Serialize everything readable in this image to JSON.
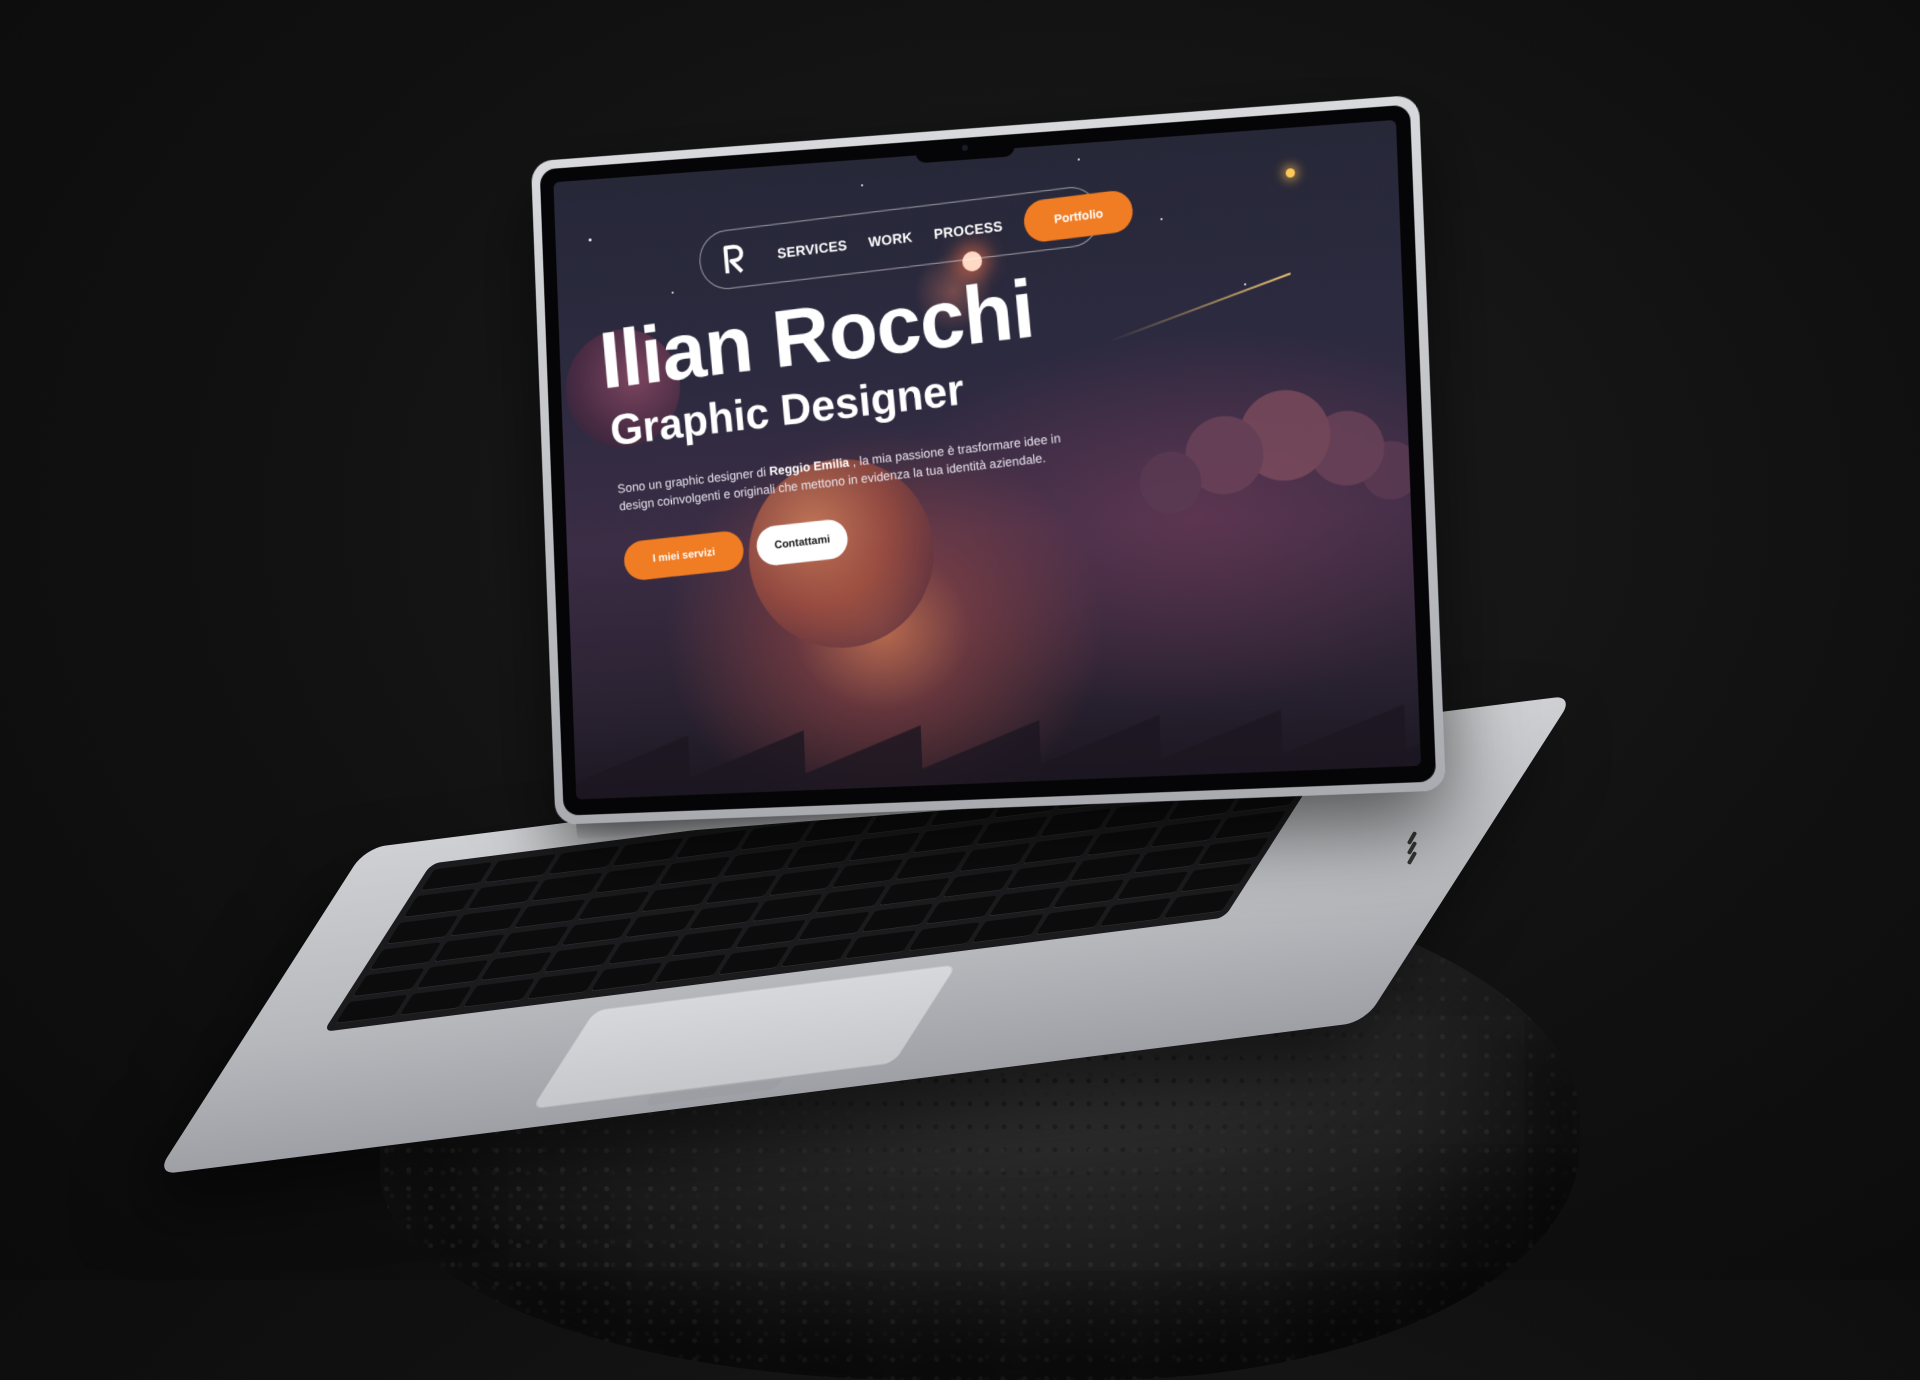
{
  "site": {
    "logo_icon": "r-monogram-icon",
    "nav": {
      "links": [
        "SERVICES",
        "WORK",
        "PROCESS"
      ],
      "cta": "Portfolio"
    },
    "hero": {
      "name": "Ilian Rocchi",
      "role": "Graphic Designer",
      "intro_before": "Sono un graphic designer di ",
      "intro_bold": "Reggio Emilia",
      "intro_after": " , la mia passione è trasformare idee in design coinvolgenti e originali che mettono in evidenza la tua identità aziendale.",
      "primary_cta": "I miei servizi",
      "secondary_cta": "Contattami"
    }
  },
  "colors": {
    "accent": "#f07c23",
    "background": "#111111",
    "text": "#ffffff"
  }
}
